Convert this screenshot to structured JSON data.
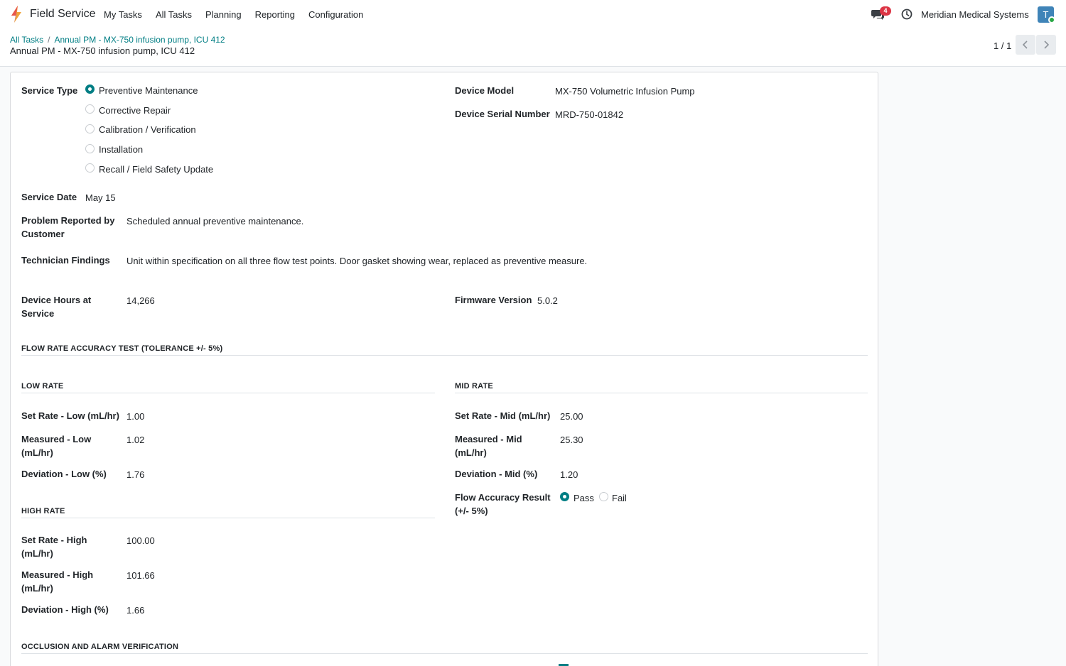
{
  "navbar": {
    "app_name": "Field Service",
    "menu": [
      "My Tasks",
      "All Tasks",
      "Planning",
      "Reporting",
      "Configuration"
    ],
    "chat_badge": "4",
    "company": "Meridian Medical Systems",
    "avatar_letter": "T"
  },
  "breadcrumb": {
    "root": "All Tasks",
    "separator": "/",
    "current": "Annual PM - MX-750 infusion pump, ICU 412"
  },
  "record_title": "Annual PM - MX-750 infusion pump, ICU 412",
  "pager": {
    "value": "1 / 1"
  },
  "form": {
    "service_type": {
      "label": "Service Type",
      "options": [
        "Preventive Maintenance",
        "Corrective Repair",
        "Calibration / Verification",
        "Installation",
        "Recall / Field Safety Update"
      ],
      "selected": "Preventive Maintenance"
    },
    "device_model": {
      "label": "Device Model",
      "value": "MX-750 Volumetric Infusion Pump"
    },
    "device_serial": {
      "label": "Device Serial Number",
      "value": "MRD-750-01842"
    },
    "service_date": {
      "label": "Service Date",
      "value": "May 15"
    },
    "problem_reported": {
      "label_line1": "Problem Reported by",
      "label_line2": "Customer",
      "value": "Scheduled annual preventive maintenance."
    },
    "technician_findings": {
      "label": "Technician Findings",
      "value": "Unit within specification on all three flow test points. Door gasket showing wear, replaced as preventive measure."
    },
    "device_hours": {
      "label_line1": "Device Hours at",
      "label_line2": "Service",
      "value": "14,266"
    },
    "firmware_version": {
      "label": "Firmware Version",
      "value": "5.0.2"
    },
    "flow_section_title": "FLOW RATE ACCURACY TEST (TOLERANCE +/- 5%)",
    "low_rate": {
      "title": "LOW RATE",
      "set_rate": {
        "label": "Set Rate - Low (mL/hr)",
        "value": "1.00"
      },
      "measured": {
        "label_line1": "Measured - Low",
        "label_line2": "(mL/hr)",
        "value": "1.02"
      },
      "deviation": {
        "label": "Deviation - Low (%)",
        "value": "1.76"
      }
    },
    "mid_rate": {
      "title": "MID RATE",
      "set_rate": {
        "label": "Set Rate - Mid (mL/hr)",
        "value": "25.00"
      },
      "measured": {
        "label_line1": "Measured - Mid",
        "label_line2": "(mL/hr)",
        "value": "25.30"
      },
      "deviation": {
        "label": "Deviation - Mid (%)",
        "value": "1.20"
      },
      "result": {
        "label_line1": "Flow Accuracy Result",
        "label_line2": "(+/- 5%)",
        "options": [
          "Pass",
          "Fail"
        ],
        "selected": "Pass"
      }
    },
    "high_rate": {
      "title": "HIGH RATE",
      "set_rate": {
        "label_line1": "Set Rate - High",
        "label_line2": "(mL/hr)",
        "value": "100.00"
      },
      "measured": {
        "label_line1": "Measured - High",
        "label_line2": "(mL/hr)",
        "value": "101.66"
      },
      "deviation": {
        "label": "Deviation - High (%)",
        "value": "1.66"
      }
    },
    "occlusion_section_title": "OCCLUSION AND ALARM VERIFICATION"
  },
  "colors": {
    "accent": "#017e84",
    "badge": "#dc3545",
    "avatar": "#3f84b8",
    "online": "#28a745"
  }
}
